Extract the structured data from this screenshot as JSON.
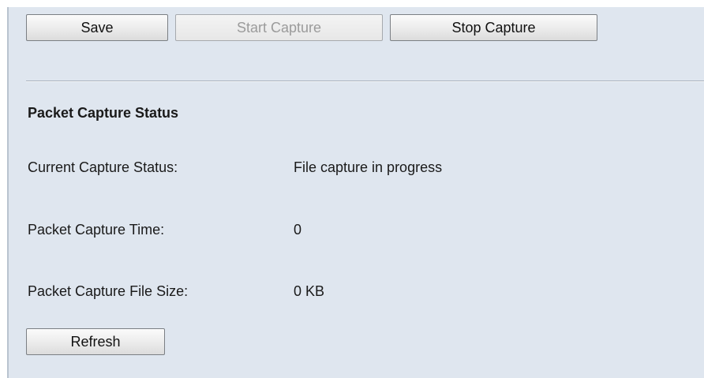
{
  "toolbar": {
    "save_label": "Save",
    "start_capture_label": "Start Capture",
    "stop_capture_label": "Stop Capture"
  },
  "status_section": {
    "title": "Packet Capture Status",
    "rows": [
      {
        "label": "Current Capture Status:",
        "value": "File capture in progress"
      },
      {
        "label": "Packet Capture Time:",
        "value": "0"
      },
      {
        "label": "Packet Capture File Size:",
        "value": "0 KB"
      }
    ]
  },
  "refresh_label": "Refresh"
}
